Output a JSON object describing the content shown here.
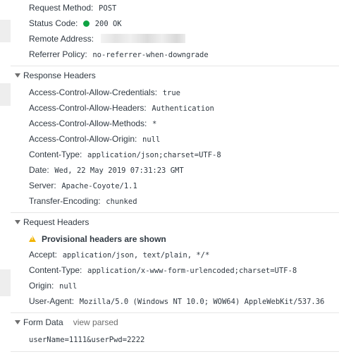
{
  "general": {
    "request_method": {
      "key": "Request Method:",
      "value": "POST"
    },
    "status_code": {
      "key": "Status Code:",
      "value": "200 OK",
      "status_color": "#0fa343"
    },
    "remote_address": {
      "key": "Remote Address:"
    },
    "referrer_policy": {
      "key": "Referrer Policy:",
      "value": "no-referrer-when-downgrade"
    }
  },
  "response_headers": {
    "title": "Response Headers",
    "items": [
      {
        "key": "Access-Control-Allow-Credentials:",
        "value": "true"
      },
      {
        "key": "Access-Control-Allow-Headers:",
        "value": "Authentication"
      },
      {
        "key": "Access-Control-Allow-Methods:",
        "value": "*"
      },
      {
        "key": "Access-Control-Allow-Origin:",
        "value": "null"
      },
      {
        "key": "Content-Type:",
        "value": "application/json;charset=UTF-8"
      },
      {
        "key": "Date:",
        "value": "Wed, 22 May 2019 07:31:23 GMT"
      },
      {
        "key": "Server:",
        "value": "Apache-Coyote/1.1"
      },
      {
        "key": "Transfer-Encoding:",
        "value": "chunked"
      }
    ]
  },
  "request_headers": {
    "title": "Request Headers",
    "warning": "Provisional headers are shown",
    "warning_icon": "warning-icon",
    "items": [
      {
        "key": "Accept:",
        "value": "application/json, text/plain, */*"
      },
      {
        "key": "Content-Type:",
        "value": "application/x-www-form-urlencoded;charset=UTF-8"
      },
      {
        "key": "Origin:",
        "value": "null"
      },
      {
        "key": "User-Agent:",
        "value": "Mozilla/5.0 (Windows NT 10.0; WOW64) AppleWebKit/537.36"
      }
    ]
  },
  "form_data": {
    "title": "Form Data",
    "view_parsed": "view parsed",
    "raw": "userName=1111&userPwd=2222"
  }
}
